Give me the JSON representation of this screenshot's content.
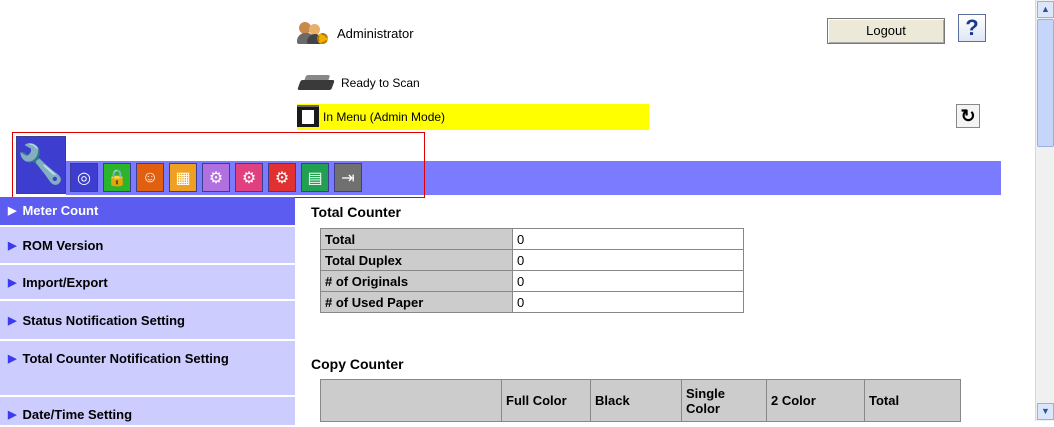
{
  "header": {
    "user_label": "Administrator",
    "logout_label": "Logout",
    "help_label": "?"
  },
  "status": {
    "scan_text": "Ready to Scan",
    "mode_text": "In Menu (Admin Mode)",
    "mode_highlight": "#ffff00"
  },
  "toolbar": {
    "icons": [
      "maintenance-icon",
      "network-icon",
      "security-icon",
      "user-auth-icon",
      "box-icon",
      "print-setting-icon",
      "store-address-icon",
      "fax-setting-icon",
      "application-icon",
      "logout-icon"
    ]
  },
  "sidebar": {
    "items": [
      {
        "label": "Meter Count",
        "active": true
      },
      {
        "label": "ROM Version"
      },
      {
        "label": "Import/Export"
      },
      {
        "label": "Status Notification Setting"
      },
      {
        "label": "Total Counter Notification Setting"
      },
      {
        "label": "Date/Time Setting"
      }
    ]
  },
  "total_counter": {
    "title": "Total Counter",
    "rows": [
      {
        "label": "Total",
        "value": "0"
      },
      {
        "label": "Total Duplex",
        "value": "0"
      },
      {
        "label": "# of Originals",
        "value": "0"
      },
      {
        "label": "# of Used Paper",
        "value": "0"
      }
    ]
  },
  "copy_counter": {
    "title": "Copy Counter",
    "headers": [
      "",
      "Full Color",
      "Black",
      "Single Color",
      "2 Color",
      "Total"
    ]
  },
  "colors": {
    "accent": "#5c5cf0",
    "band": "#7b7bff",
    "sidebar_bg": "#ccccff",
    "table_header": "#cccccc"
  }
}
